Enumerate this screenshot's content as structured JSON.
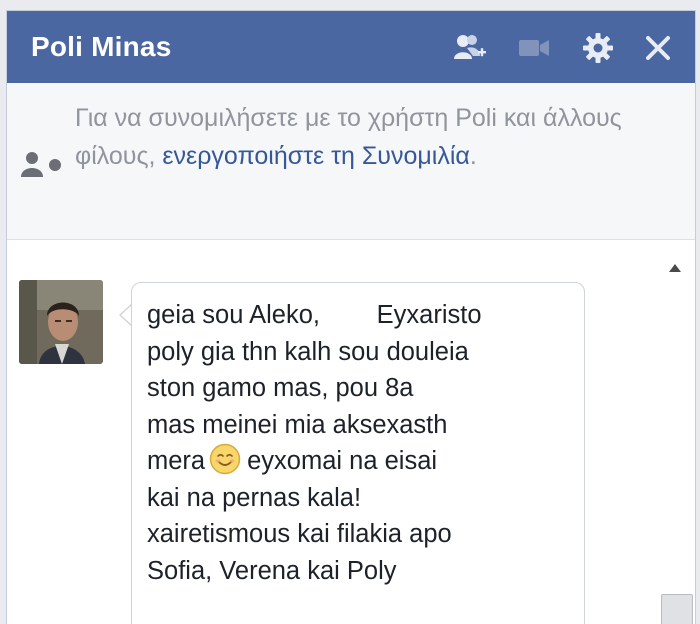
{
  "chat": {
    "title": "Poli Minas",
    "header_icons": [
      "add-friend-icon",
      "video-call-icon",
      "gear-icon",
      "close-icon"
    ]
  },
  "notice": {
    "text_prefix": "Για να συνομιλήσετε με το χρήστη Poli και άλλους φίλους, ",
    "link": "ενεργοποιήστε τη Συνομιλία",
    "text_suffix": "."
  },
  "message": {
    "lines": [
      "geia sou Aleko,        Eyxaristo",
      "poly gia thn kalh sou douleia",
      "ston gamo mas, pou 8a",
      "mas meinei mia aksexasth",
      "mera",
      "eyxomai na eisai",
      "kai na pernas kala!",
      "xairetismous kai filakia apo",
      "Sofia, Verena kai Poly"
    ],
    "emoji": "smiling-face-icon"
  },
  "colors": {
    "header_bg": "#4b67a1",
    "link": "#365899",
    "notice_text": "#90949c"
  }
}
